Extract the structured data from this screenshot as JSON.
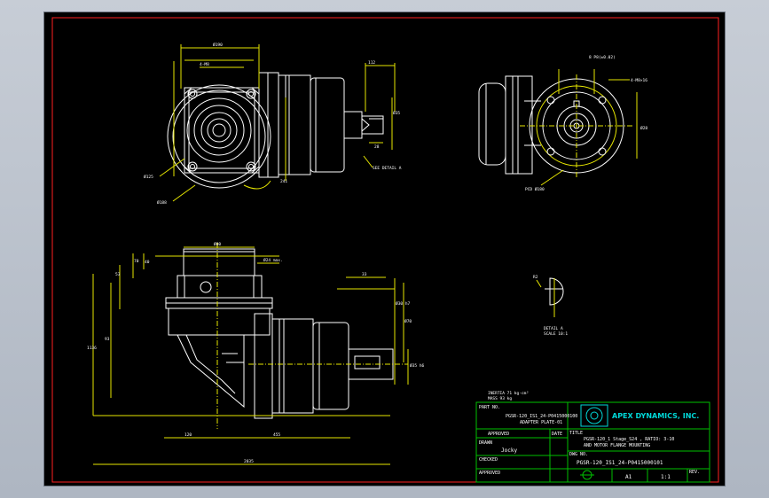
{
  "dimensions": {
    "top_view_d1": "Ø190",
    "top_view_d2": "Ø196",
    "top_view_d3": "Ø125",
    "top_view_d4": "Ø188",
    "top_view_h": "241",
    "shaft_len": "112",
    "shaft_d": "Ø35",
    "shaft_w": "28",
    "see_detail": "SEE DETAIL A",
    "right_view_key": "8 P8(±0.02)",
    "right_view_holes": "4-M8×16",
    "right_view_pcd": "PCD Ø180",
    "right_view_d": "Ø28",
    "side_top": "Ø80",
    "side_d2": "Ø24 max.",
    "side_h1": "1136",
    "side_h2": "93",
    "side_h3": "53",
    "side_h4": "70",
    "side_h5": "40",
    "side_h6": "33",
    "side_len1": "120",
    "side_len2": "455",
    "side_len3": "2035",
    "side_d_shaft": "Ø70",
    "side_d_flange": "Ø30 h7",
    "side_d_key": "Ø35 h6",
    "side_r": "R2",
    "detail_label": "DETAIL A",
    "detail_scale": "SCALE 10:1"
  },
  "notes": {
    "inertia": "INERTIA 71 kg-cm²",
    "mass": "MASS 93 kg"
  },
  "title_block": {
    "part_no_label": "PART NO.",
    "part_no_line1": "PGSR-120_IS1_24-P0415000100",
    "part_no_line2": "ADAPTER PLATE-01",
    "approved_label": "APPROVED",
    "date_label": "DATE",
    "drawn_label": "DRAWN",
    "drawn_by": "Jocky",
    "checked_label": "CHECKED",
    "approved2_label": "APPROVED",
    "company": "APEX DYNAMICS, INC.",
    "title_label": "TITLE",
    "title_line1": "PGSR-120_1 Stage_S24 , RATIO: 3-10",
    "title_line2": "AND MOTOR FLANGE MOUNTING",
    "dwg_no_label": "DWG NO.",
    "dwg_no": "PGSR-120_IS1_24-P0415000101",
    "size": "A1",
    "scale": "1:1",
    "rev_label": "REV."
  },
  "colors": {
    "background": "#000000",
    "border": "#ff2020",
    "outline": "#ffffff",
    "dimension": "#e6e600",
    "title_block": "#00c000",
    "logo": "#00d8d8"
  }
}
